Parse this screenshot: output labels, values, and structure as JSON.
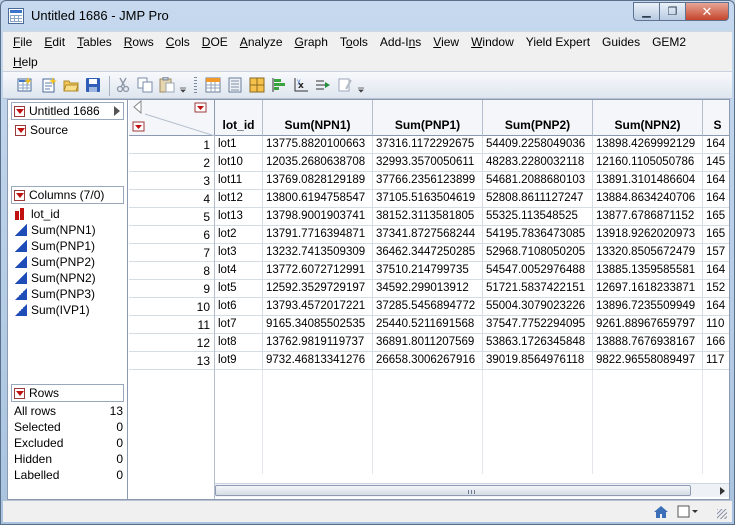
{
  "window": {
    "title": "Untitled 1686 - JMP Pro"
  },
  "menu": {
    "row1": [
      {
        "label": "File",
        "u": "F",
        "rest": "ile"
      },
      {
        "label": "Edit",
        "u": "E",
        "rest": "dit"
      },
      {
        "label": "Tables",
        "u": "T",
        "rest": "ables"
      },
      {
        "label": "Rows",
        "u": "R",
        "rest": "ows"
      },
      {
        "label": "Cols",
        "u": "C",
        "rest": "ols"
      },
      {
        "label": "DOE",
        "u": "D",
        "rest": "OE"
      },
      {
        "label": "Analyze",
        "u": "A",
        "rest": "nalyze"
      },
      {
        "label": "Graph",
        "u": "G",
        "rest": "raph"
      },
      {
        "label": "Tools",
        "pre": "T",
        "u": "o",
        "rest": "ols"
      },
      {
        "label": "Add-Ins",
        "pre": "Add-I",
        "u": "n",
        "rest": "s"
      },
      {
        "label": "View",
        "u": "V",
        "rest": "iew"
      },
      {
        "label": "Window",
        "u": "W",
        "rest": "indow"
      },
      {
        "label": "Yield Expert",
        "u": "",
        "rest": "Yield Expert"
      },
      {
        "label": "Guides",
        "u": "",
        "rest": "Guides"
      },
      {
        "label": "GEM2",
        "u": "",
        "rest": "GEM2"
      }
    ],
    "row2": [
      {
        "label": "Help",
        "u": "H",
        "rest": "elp"
      }
    ]
  },
  "left_panel": {
    "table_name": "Untitled 1686",
    "source": "Source",
    "columns_header": "Columns (7/0)",
    "columns": [
      "lot_id",
      "Sum(NPN1)",
      "Sum(PNP1)",
      "Sum(PNP2)",
      "Sum(NPN2)",
      "Sum(PNP3)",
      "Sum(IVP1)"
    ],
    "rows_header": "Rows",
    "row_stats": [
      {
        "label": "All rows",
        "value": "13"
      },
      {
        "label": "Selected",
        "value": "0"
      },
      {
        "label": "Excluded",
        "value": "0"
      },
      {
        "label": "Hidden",
        "value": "0"
      },
      {
        "label": "Labelled",
        "value": "0"
      }
    ]
  },
  "table": {
    "headers": [
      "lot_id",
      "Sum(NPN1)",
      "Sum(PNP1)",
      "Sum(PNP2)",
      "Sum(NPN2)",
      "S"
    ],
    "rows": [
      [
        "1",
        "lot1",
        "13775.8820100663",
        "37316.1172292675",
        "54409.2258049036",
        "13898.4269992129",
        "164"
      ],
      [
        "2",
        "lot10",
        "12035.2680638708",
        "32993.3570050611",
        "48283.2280032118",
        "12160.1105050786",
        "145"
      ],
      [
        "3",
        "lot11",
        "13769.0828129189",
        "37766.2356123899",
        "54681.2088680103",
        "13891.3101486604",
        "164"
      ],
      [
        "4",
        "lot12",
        "13800.6194758547",
        "37105.5163504619",
        "52808.8611127247",
        "13884.8634240706",
        "164"
      ],
      [
        "5",
        "lot13",
        "13798.9001903741",
        "38152.3113581805",
        "55325.113548525",
        "13877.6786871152",
        "165"
      ],
      [
        "6",
        "lot2",
        "13791.7716394871",
        "37341.8727568244",
        "54195.7836473085",
        "13918.9262020973",
        "165"
      ],
      [
        "7",
        "lot3",
        "13232.7413509309",
        "36462.3447250285",
        "52968.7108050205",
        "13320.8505672479",
        "157"
      ],
      [
        "8",
        "lot4",
        "13772.6072712991",
        "37510.214799735",
        "54547.0052976488",
        "13885.1359585581",
        "164"
      ],
      [
        "9",
        "lot5",
        "12592.3529729197",
        "34592.299013912",
        "51721.5837422151",
        "12697.1618233871",
        "152"
      ],
      [
        "10",
        "lot6",
        "13793.4572017221",
        "37285.5456894772",
        "55004.3079023226",
        "13896.7235509949",
        "164"
      ],
      [
        "11",
        "lot7",
        "9165.34085502535",
        "25440.5211691568",
        "37547.7752294095",
        "9261.88967659797",
        "110"
      ],
      [
        "12",
        "lot8",
        "13762.9819119737",
        "36891.8011207569",
        "53863.1726345848",
        "13888.7676938167",
        "166"
      ],
      [
        "13",
        "lot9",
        "9732.46813341276",
        "26658.3006267916",
        "39019.8564976118",
        "9822.96558089497",
        "117"
      ]
    ]
  },
  "colors": {
    "accent": "#1e4db7",
    "red_marker": "#c01010",
    "frame": "#a9c3df"
  }
}
